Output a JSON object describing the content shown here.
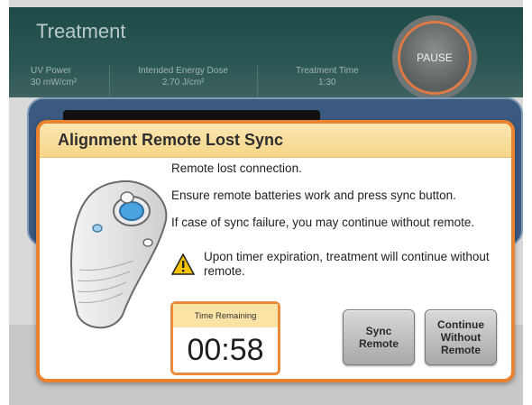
{
  "app": {
    "title": "Treatment",
    "pause_label": "PAUSE"
  },
  "params": [
    {
      "label": "UV Power",
      "value": "30 mW/cm²"
    },
    {
      "label": "Intended Energy Dose",
      "value": "2.70 J/cm²"
    },
    {
      "label": "Treatment Time",
      "value": "1:30"
    }
  ],
  "modal": {
    "title": "Alignment Remote Lost Sync",
    "line1": "Remote lost connection.",
    "line2": "Ensure remote batteries work and press sync button.",
    "line3": "If case of sync failure, you may continue without remote.",
    "warning": "Upon timer expiration, treatment will continue without remote.",
    "timer_label": "Time Remaining",
    "timer_value": "00:58",
    "sync_label": "Sync\nRemote",
    "continue_label": "Continue\nWithout\nRemote"
  },
  "colors": {
    "accent": "#e9832f",
    "header": "#2a5653",
    "modal_header": "#f6d688"
  }
}
